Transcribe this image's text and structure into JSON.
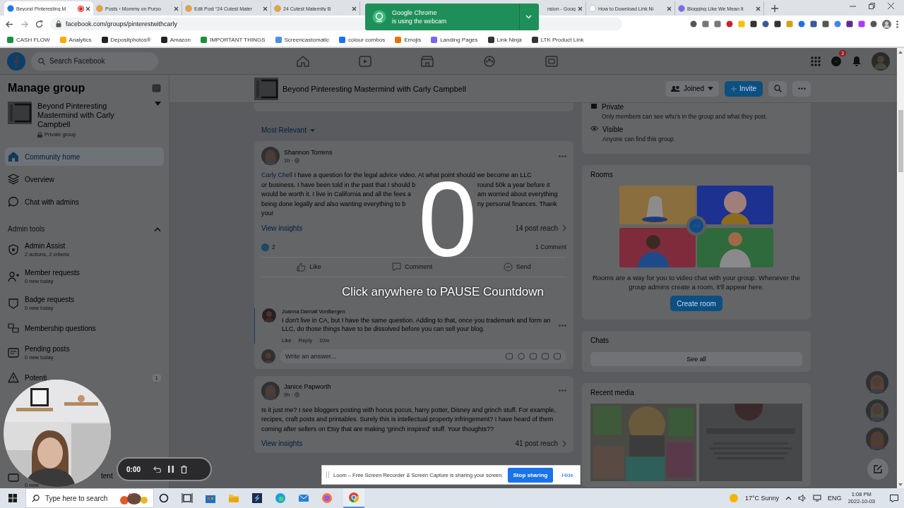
{
  "browser": {
    "tabs": [
      {
        "title": "Beyond Pinteresting M",
        "selected": true,
        "recording": true
      },
      {
        "title": "Posts ‹ Mommy on Purpo",
        "selected": false,
        "recording": false
      },
      {
        "title": "Edit Post “24 Cutest Mater",
        "selected": false,
        "recording": false
      },
      {
        "title": "24 Cutest Maternity B",
        "selected": false,
        "recording": false
      },
      {
        "title": "nsion - Goog",
        "selected": false,
        "recording": false,
        "kind": "covered"
      },
      {
        "title": "How to Download Link Ni",
        "selected": false,
        "recording": false
      },
      {
        "title": "Blogging Like We Mean It",
        "selected": false,
        "recording": false
      }
    ],
    "address": "facebook.com/groups/pinterestwithcarly",
    "bookmarks": [
      "CASH FLOW",
      "Analytics",
      "Depositphotos®",
      "Amazon",
      "IMPORTANT THINGS",
      "Screencastomatic",
      "colour combos",
      "Emojis",
      "Landing Pages",
      "Link Ninja",
      "LTK Product Link"
    ]
  },
  "chrome_notification": {
    "title": "Google Chrome",
    "text": "is using the webcam"
  },
  "facebook": {
    "search_placeholder": "Search Facebook",
    "messenger_badge": "3"
  },
  "sidebar": {
    "title": "Manage group",
    "group": {
      "name": "Beyond Pinteresting Mastermind with Carly Campbell",
      "privacy": "Private group"
    },
    "items": [
      {
        "label": "Community home",
        "selected": true
      },
      {
        "label": "Overview",
        "selected": false
      },
      {
        "label": "Chat with admins",
        "selected": false
      }
    ],
    "admin_tools": {
      "title": "Admin tools",
      "expanded": true,
      "items": [
        {
          "title": "Admin Assist",
          "subtitle": "2 actions, 2 criteria"
        },
        {
          "title": "Member requests",
          "subtitle": "0 new today"
        },
        {
          "title": "Badge requests",
          "subtitle": "0 new today"
        },
        {
          "title": "Membership questions"
        },
        {
          "title": "Pending posts",
          "subtitle": "0 new today"
        },
        {
          "title": "Potenti",
          "count": "1"
        },
        {
          "title": "tent",
          "subtitle": "0 new",
          "kind": "cut"
        }
      ]
    }
  },
  "group_header": {
    "name": "Beyond Pinteresting Mastermind with Carly Campbell",
    "joined": "Joined",
    "invite": "Invite"
  },
  "feed": {
    "sort": "Most Relevant",
    "posts": [
      {
        "author": "Shannon Torrens",
        "time": "1h ·",
        "mention": "Carly Chell",
        "lines": [
          [
            "I have a question for the legal advice video. At what point should we become an LLC"
          ],
          [
            "or business.  I have been told in the past that I should b",
            "round 50k a year before it"
          ],
          [
            "would be worth it. I live in California and all the fees a",
            "am worried about everything"
          ],
          [
            "being done legally and also wanting everything to b",
            "ny personal finances. Thank"
          ],
          [
            "you!"
          ]
        ],
        "insights": "View insights",
        "reach": "14 post reach",
        "reactions": "2",
        "comments": "1 Comment",
        "actions": [
          "Like",
          "Comment",
          "Send"
        ],
        "replies": [
          {
            "author": "Joanna Darnall VonBergen",
            "text": "I don't live in CA, but I have the same question. Adding to that, once you trademark and form an LLC, do those things have to be dissolved before you can sell your blog.",
            "actions": [
              "Like",
              "Reply"
            ],
            "time": "10m"
          }
        ],
        "reply_placeholder": "Write an answer..."
      },
      {
        "author": "Janice Papworth",
        "time": "9h ·",
        "text": "Is it just me? I see bloggers posting with hocus pocus, harry potter, Disney and grinch stuff. For example, recipes, craft posts and printables. Surely this is intellectual property infringement? I have heard of them coming after sellers on Etsy that are making 'grinch inspired' stuff. Your thoughts??",
        "insights": "View insights",
        "reach": "41 post reach"
      }
    ]
  },
  "about": [
    {
      "title": "Private",
      "text": "Only members can see who's in the group and what they post."
    },
    {
      "title": "Visible",
      "text": "Anyone can find this group."
    }
  ],
  "rooms": {
    "title": "Rooms",
    "text": "Rooms are a way for you to video chat with your group. Whenever the group admins create a room, it'll appear here.",
    "button": "Create room"
  },
  "chats": {
    "title": "Chats",
    "button": "See all"
  },
  "recent_media": {
    "title": "Recent media"
  },
  "loom": {
    "countdown": "0",
    "hint": "Click anywhere to PAUSE Countdown",
    "timer": "0:00",
    "banner": "Loom – Free Screen Recorder & Screen Capture is sharing your screen.",
    "stop": "Stop sharing",
    "hide": "Hide"
  },
  "taskbar": {
    "search_placeholder": "Type here to search",
    "weather": "17°C Sunny",
    "language": "ENG",
    "time": "1:08 PM",
    "date": "2022-10-03"
  }
}
